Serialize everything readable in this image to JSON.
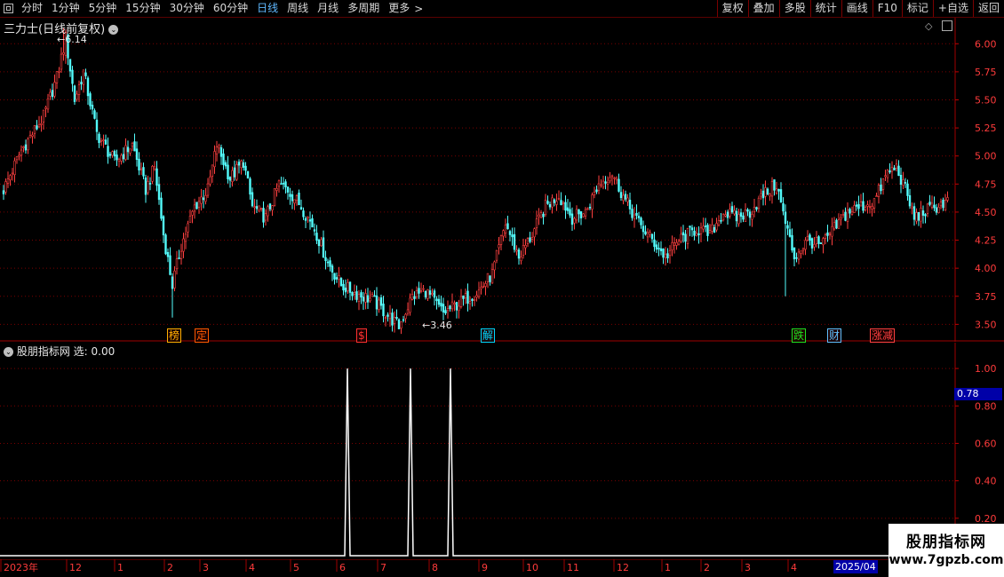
{
  "toolbar": {
    "tabs": [
      "分时",
      "1分钟",
      "5分钟",
      "15分钟",
      "30分钟",
      "60分钟",
      "日线",
      "周线",
      "月线",
      "多周期",
      "更多"
    ],
    "active_tab": "日线",
    "more_suffix": ">",
    "right_buttons": [
      "复权",
      "叠加",
      "多股",
      "统计",
      "画线",
      "F10",
      "标记",
      "+自选",
      "返回"
    ]
  },
  "main_panel": {
    "title": "三力士(日线前复权)",
    "high_label": "6.14",
    "low_label": "3.46",
    "event_tags": [
      {
        "text": "榜",
        "color": "#ffb000"
      },
      {
        "text": "定",
        "color": "#ff5a00"
      },
      {
        "text": "$",
        "color": "#ff3030"
      },
      {
        "text": "解",
        "color": "#00d8ff"
      },
      {
        "text": "跌",
        "color": "#20e020"
      },
      {
        "text": "财",
        "color": "#60c0ff"
      },
      {
        "text": "涨减",
        "color": "#ff4040"
      }
    ],
    "y_ticks": [
      "6.00",
      "5.75",
      "5.50",
      "5.25",
      "5.00",
      "4.75",
      "4.50",
      "4.25",
      "4.00",
      "3.75",
      "3.50"
    ]
  },
  "indicator_panel": {
    "title": "股朋指标网",
    "value_label": "选: 0.00",
    "y_ticks": [
      "1.00",
      "0.80",
      "0.60",
      "0.40",
      "0.20"
    ],
    "cursor_value": "0.78"
  },
  "x_axis": {
    "labels": [
      "2023年",
      "12",
      "1",
      "2",
      "3",
      "4",
      "5",
      "6",
      "7",
      "8",
      "9",
      "10",
      "11",
      "12",
      "1",
      "2",
      "3",
      "4"
    ],
    "end_label": "2025/04"
  },
  "watermark": {
    "title": "股朋指标网",
    "url": "www.7gpzb.com"
  },
  "colors": {
    "up": "#ff4040",
    "down": "#54ffff",
    "grid": "#7a0000",
    "axis_text": "#ff3b3b",
    "active_tab": "#5fb8ff"
  },
  "chart_data": {
    "type": "candlestick",
    "price_range": [
      3.4,
      6.2
    ],
    "high": 6.14,
    "low": 3.46,
    "indicator": {
      "name": "选",
      "range": [
        0,
        1.1
      ],
      "signals": [
        1,
        1,
        1
      ]
    }
  }
}
